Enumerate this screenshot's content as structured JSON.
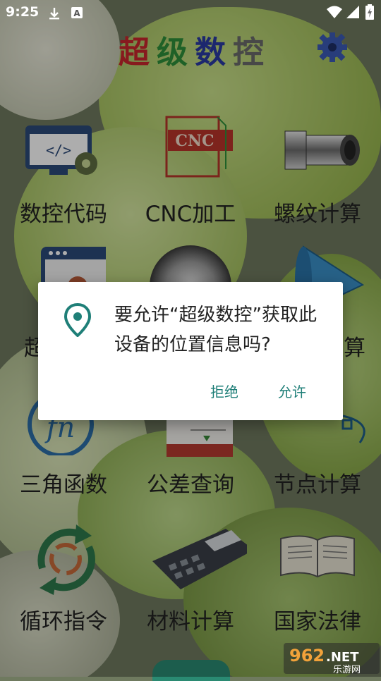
{
  "status_bar": {
    "time": "9:25",
    "left_icons": [
      "download-icon",
      "a-icon"
    ],
    "right_icons": [
      "wifi-icon",
      "signal-icon",
      "battery-icon"
    ]
  },
  "app": {
    "title_chars": [
      "超",
      "级",
      "数",
      "控"
    ],
    "title_colors": [
      "#c8272d",
      "#2f8f3a",
      "#2a3aa3",
      "#6a6a6a"
    ],
    "settings_icon": "gear-icon"
  },
  "tiles": [
    {
      "label": "数控代码",
      "icon": "code-monitor-icon"
    },
    {
      "label": "CNC加工",
      "icon": "cnc-icon"
    },
    {
      "label": "螺纹计算",
      "icon": "pipe-fitting-icon"
    },
    {
      "label": "超",
      "icon": "window-gear-icon"
    },
    {
      "label": "",
      "icon": "metal-disc-icon"
    },
    {
      "label": "算",
      "icon": "cone-icon"
    },
    {
      "label": "三角函数",
      "icon": "function-icon"
    },
    {
      "label": "公差查询",
      "icon": "drawing-icon"
    },
    {
      "label": "节点计算",
      "icon": "node-icon"
    },
    {
      "label": "循环指令",
      "icon": "cycle-arrows-icon"
    },
    {
      "label": "材料计算",
      "icon": "calculator-icon"
    },
    {
      "label": "国家法律",
      "icon": "book-icon"
    }
  ],
  "dialog": {
    "icon": "location-pin-icon",
    "message": "要允许“超级数控”获取此设备的位置信息吗?",
    "deny_label": "拒绝",
    "allow_label": "允许"
  },
  "colors": {
    "accent": "#1f7f78",
    "background": "#7d8b62"
  },
  "watermark": {
    "brand": "962.NET",
    "sub": "乐游网"
  }
}
